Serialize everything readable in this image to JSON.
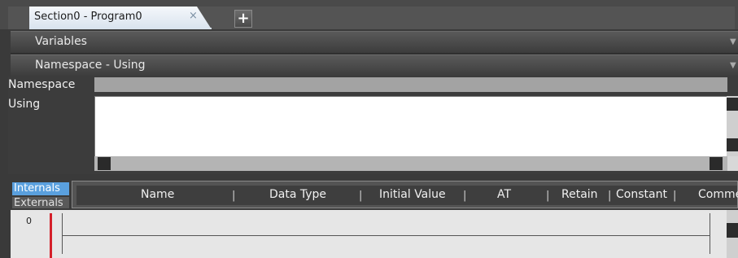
{
  "tab": {
    "title": "Section0 - Program0",
    "close_glyph": "×"
  },
  "add_tab": {
    "glyph": "+"
  },
  "sections": {
    "variables": {
      "label": "Variables",
      "arrow": "▼"
    },
    "namespace": {
      "label": "Namespace - Using",
      "arrow": "▼"
    }
  },
  "namespace_panel": {
    "namespace_label": "Namespace",
    "using_label": "Using"
  },
  "variable_tabs": {
    "internals": "Internals",
    "externals": "Externals"
  },
  "table": {
    "columns": [
      "Name",
      "Data Type",
      "Initial Value",
      "AT",
      "Retain",
      "Constant",
      "Comme"
    ],
    "separator": "|"
  },
  "ladder": {
    "rung_number": "0"
  },
  "colors": {
    "accent": "#5aa0de",
    "power_rail": "#d4202a",
    "tab_bg": "#d9e3ee"
  }
}
